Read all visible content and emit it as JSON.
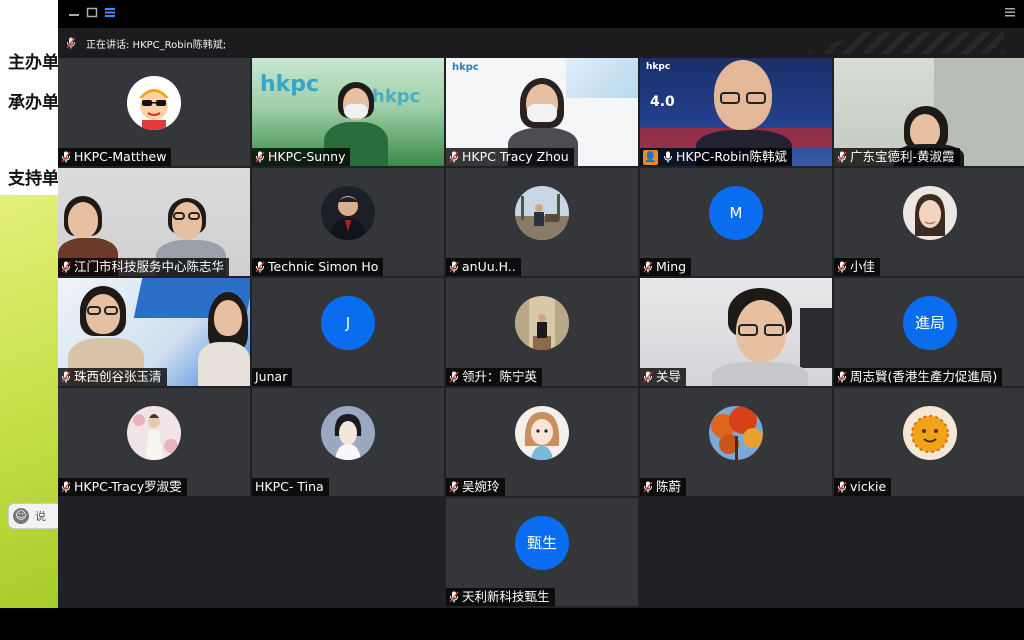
{
  "slide": {
    "lines": [
      "主办单",
      "承办单",
      "支持单"
    ],
    "chat_placeholder": "说"
  },
  "speaker_bar": {
    "label": "正在讲话: HKPC_Robin陈韩斌;"
  },
  "participants": [
    {
      "name": "HKPC-Matthew",
      "mic": "muted",
      "kind": "avatar-image",
      "avatar": "cartoon-sunglasses"
    },
    {
      "name": "HKPC-Sunny",
      "mic": "muted",
      "kind": "video"
    },
    {
      "name": "HKPC Tracy Zhou",
      "mic": "muted",
      "kind": "video"
    },
    {
      "name": "HKPC-Robin陈韩斌",
      "mic": "active",
      "kind": "video",
      "badge": "person-icon"
    },
    {
      "name": "广东宝德利-黄淑霞",
      "mic": "muted",
      "kind": "video"
    },
    {
      "name": "江门市科技服务中心陈志华",
      "mic": "muted",
      "kind": "video"
    },
    {
      "name": "Technic Simon Ho",
      "mic": "muted",
      "kind": "avatar-image",
      "avatar": "man-suit"
    },
    {
      "name": "anUu.H..",
      "mic": "muted",
      "kind": "avatar-image",
      "avatar": "outdoor-photo"
    },
    {
      "name": "Ming",
      "mic": "muted",
      "kind": "letter",
      "letter": "M"
    },
    {
      "name": "小佳",
      "mic": "muted",
      "kind": "avatar-image",
      "avatar": "woman-portrait"
    },
    {
      "name": "珠西创谷张玉清",
      "mic": "muted",
      "kind": "video"
    },
    {
      "name": "Junar",
      "mic": "none",
      "kind": "letter",
      "letter": "J"
    },
    {
      "name": "领升：陈宁英",
      "mic": "muted",
      "kind": "avatar-image",
      "avatar": "hallway-photo"
    },
    {
      "name": "关导",
      "mic": "muted",
      "kind": "video"
    },
    {
      "name": "周志賢(香港生產力促進局)",
      "mic": "muted",
      "kind": "letter",
      "letter": "進局"
    },
    {
      "name": "HKPC-Tracy罗淑雯",
      "mic": "muted",
      "kind": "avatar-image",
      "avatar": "woman-dress"
    },
    {
      "name": "HKPC- Tina",
      "mic": "none",
      "kind": "avatar-image",
      "avatar": "woman-illustration"
    },
    {
      "name": "吴婉玲",
      "mic": "muted",
      "kind": "avatar-image",
      "avatar": "anime-girl"
    },
    {
      "name": "陈蔚",
      "mic": "muted",
      "kind": "avatar-image",
      "avatar": "autumn-tree"
    },
    {
      "name": "vickie",
      "mic": "muted",
      "kind": "avatar-image",
      "avatar": "yellow-emoji"
    },
    {
      "name": "天利新科技甄生",
      "mic": "muted",
      "kind": "letter",
      "letter": "甄生"
    }
  ],
  "video_text": {
    "hkpc_logo": "hkpc",
    "industry": "4.0"
  },
  "colors": {
    "tile_bg": "#35363a",
    "letter_avatar": "#0a6df0",
    "window_bg": "#202124",
    "mic_muted": "#e53935"
  }
}
